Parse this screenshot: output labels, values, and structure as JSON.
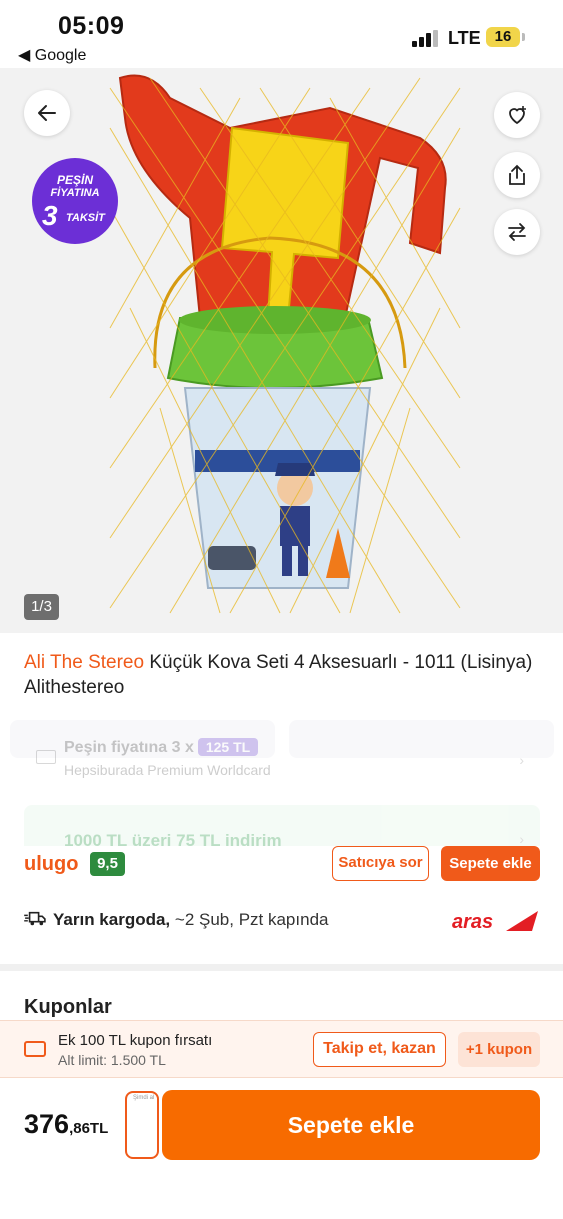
{
  "status_bar": {
    "time": "05:09",
    "back_app": "◀ Google",
    "network": "LTE",
    "battery": "16"
  },
  "hero": {
    "badge": {
      "line1": "PEŞİN",
      "line2": "FİYATINA",
      "line3": "3",
      "line4": "TAKSİT"
    },
    "counter": "1/3",
    "icons": [
      "back-arrow-icon",
      "favorite-heart-icon",
      "share-icon",
      "compare-icon"
    ]
  },
  "product": {
    "brand": "Ali The Stereo",
    "title": " Küçük Kova Seti 4 Aksesuarlı - 1011 (Lisinya) Alithestereo"
  },
  "installment": {
    "text": "Peşin fiyatına 3 x",
    "amount": "125 TL",
    "card": "Hepsiburada Premium Worldcard"
  },
  "discount": {
    "text": "1000 TL üzeri 75 TL indirim"
  },
  "seller": {
    "name": "ulugo",
    "score": "9,5",
    "ask_label": "Satıcıya sor",
    "add_label": "Sepete ekle"
  },
  "shipping": {
    "bold": "Yarın kargoda,",
    "detail": " ~2 Şub, Pzt kapında",
    "carrier": "aras"
  },
  "coupons": {
    "title": "Kuponlar",
    "offer": "Ek 100 TL kupon fırsatı",
    "limit": "Alt limit: 1.500 TL",
    "follow_label": "Takip et, kazan",
    "more_label": "+1 kupon"
  },
  "bottom_bar": {
    "price_int": "376",
    "price_dec": ",86",
    "currency": "TL",
    "add_to_cart": "Sepete ekle",
    "fav_mini": "Şimdi al"
  },
  "colors": {
    "accent": "#f05a1a",
    "cta": "#f76b00",
    "badge_purple": "#6c2fd6",
    "score_green": "#2e8b3e",
    "carrier_red": "#e31e24"
  }
}
